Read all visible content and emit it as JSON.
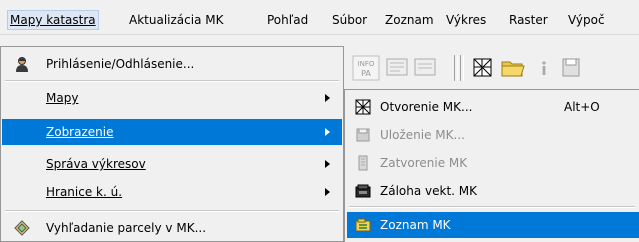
{
  "menubar": {
    "items": [
      {
        "label": "Mapy katastra"
      },
      {
        "label": "Aktualizácia MK"
      },
      {
        "label": "Pohľad"
      },
      {
        "label": "Súbor"
      },
      {
        "label": "Zoznam"
      },
      {
        "label": "Výkres"
      },
      {
        "label": "Raster"
      },
      {
        "label": "Výpoč"
      }
    ]
  },
  "toolbar": {
    "info_line1": "INFO",
    "info_line2": "PA"
  },
  "dropdown": {
    "items": [
      {
        "label": "Prihlásenie/Odhlásenie..."
      },
      {
        "label": "Mapy"
      },
      {
        "label": "Zobrazenie"
      },
      {
        "label": "Správa výkresov"
      },
      {
        "label": "Hranice k. ú."
      },
      {
        "label": "Vyhľadanie parcely v MK..."
      }
    ]
  },
  "submenu": {
    "items": [
      {
        "label": "Otvorenie MK...",
        "shortcut": "Alt+O"
      },
      {
        "label": "Uloženie MK..."
      },
      {
        "label": "Zatvorenie MK"
      },
      {
        "label": "Záloha vekt. MK"
      },
      {
        "label": "Zoznam MK"
      }
    ]
  },
  "colors": {
    "highlight": "#0078d7",
    "disabled_text": "#8d8d8d",
    "menu_bg": "#f0f0f0"
  }
}
